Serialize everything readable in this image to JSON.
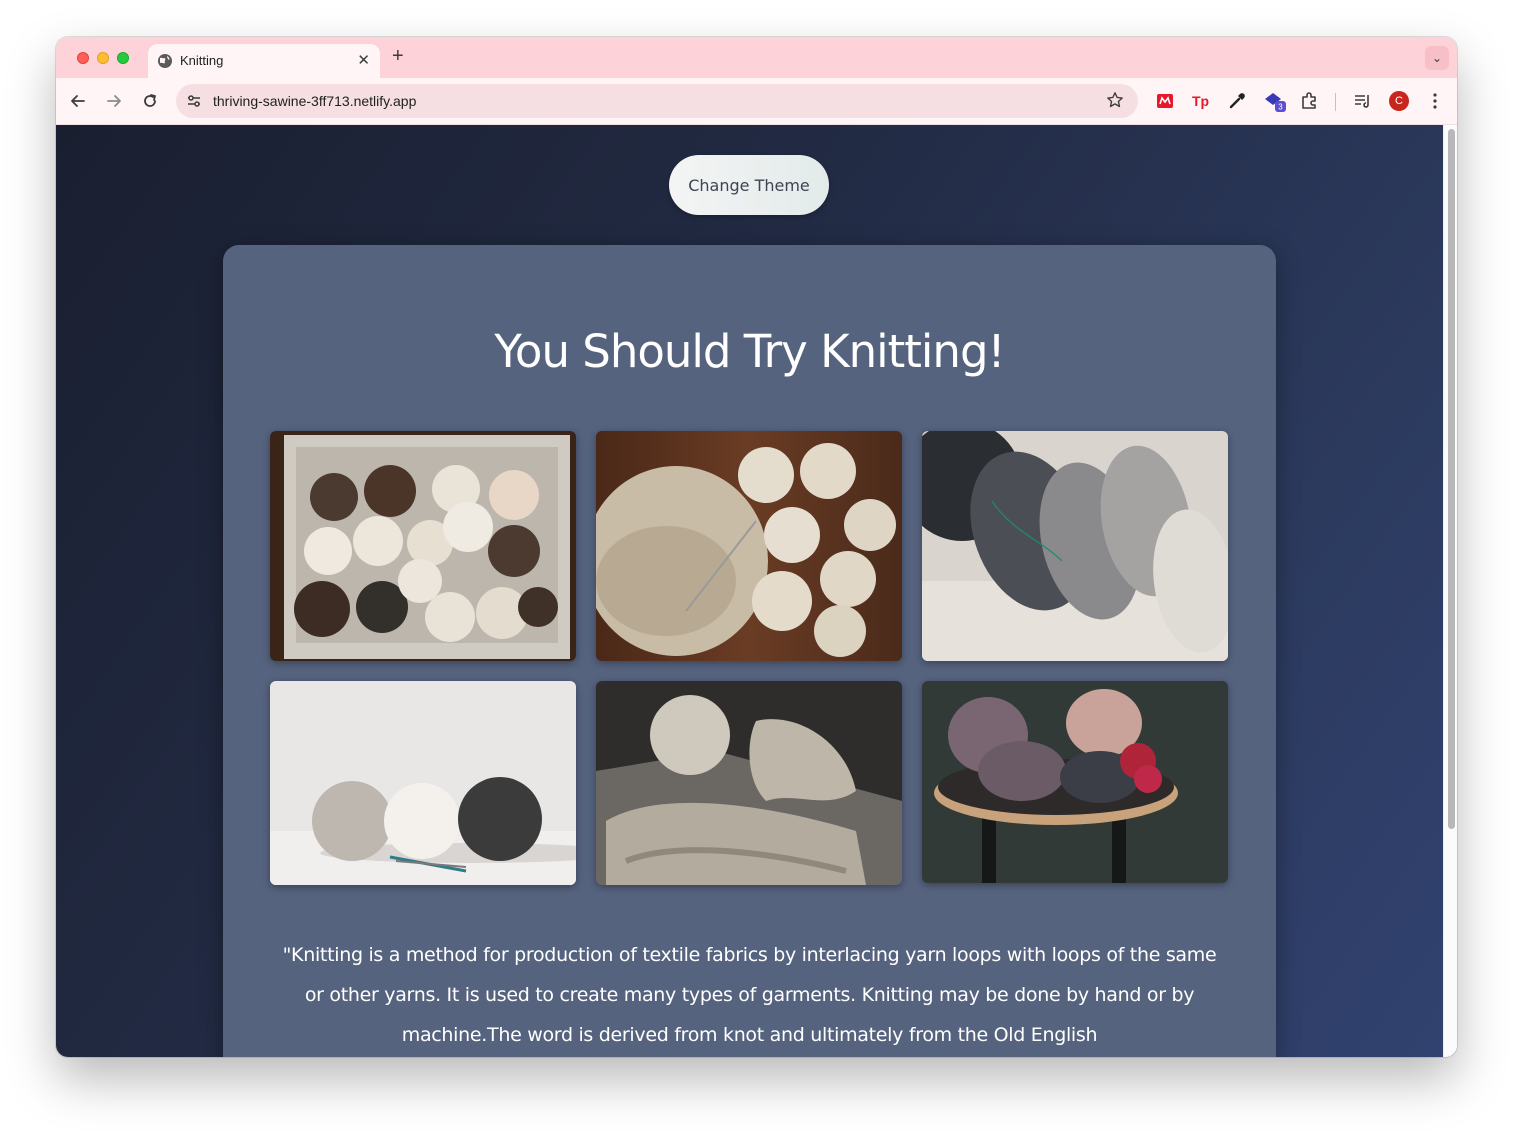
{
  "browser": {
    "tab_title": "Knitting",
    "tab_close_glyph": "✕",
    "new_tab_glyph": "+",
    "tab_menu_glyph": "⌄",
    "url": "thriving-sawine-3ff713.netlify.app",
    "extension_badge_count": "3",
    "profile_initial": "C",
    "icons": [
      "back-icon",
      "forward-icon",
      "reload-icon",
      "site-settings-icon",
      "bookmark-star-icon",
      "extension-icon",
      "reading-list-icon",
      "more-menu-icon"
    ]
  },
  "page": {
    "theme_button_label": "Change Theme",
    "headline": "You Should Try Knitting!",
    "quote_text": "\"Knitting is a method for production of textile fabrics by interlacing yarn loops with loops of the same or other yarns. It is used to create many types of garments. Knitting may be done by hand or by machine.The word is derived from knot and ultimately from the Old English",
    "photos": [
      {
        "name": "yarn-box-photo",
        "subject": "box of brown and cream yarn balls"
      },
      {
        "name": "cream-yarn-knit-photo",
        "subject": "cream yarn balls with knitted piece"
      },
      {
        "name": "grey-skeins-photo",
        "subject": "grey and charcoal yarn skeins"
      },
      {
        "name": "three-yarn-balls-photo",
        "subject": "three yarn balls with needles"
      },
      {
        "name": "chunky-knit-photo",
        "subject": "chunky cream knit and yarn"
      },
      {
        "name": "yarn-bowl-photo",
        "subject": "mauve yarn skeins on a wooden tray"
      }
    ]
  },
  "colors": {
    "tab_strip": "#fdd2d8",
    "card": "#56637f",
    "background_start": "#1a1f30",
    "background_end": "#314270"
  }
}
